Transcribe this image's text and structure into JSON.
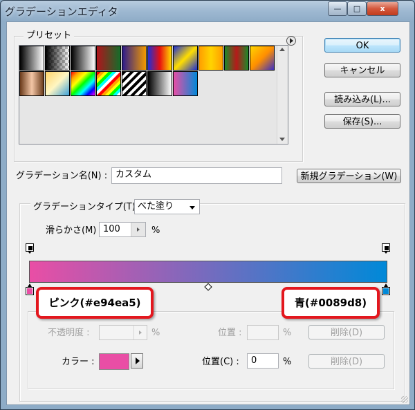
{
  "window": {
    "title": "グラデーションエディタ",
    "minimize_glyph": "—",
    "maximize_glyph": "□",
    "close_glyph": "x"
  },
  "presets": {
    "label": "プリセット",
    "menu_icon": "circle-arrow-right-icon",
    "swatches": [
      "linear-gradient(90deg,#000,#fff)",
      "linear-gradient(90deg,#000,#fff) , repeating-conic-gradient(#ccc 0 25%,#fff 0 50%)",
      "linear-gradient(90deg,#000,#fff)",
      "linear-gradient(90deg,#b0141c,#146d2a)",
      "linear-gradient(90deg,#2c1b8c,#f29a00)",
      "linear-gradient(90deg,#1f2fd6,#e80f0f,#ffde00)",
      "linear-gradient(135deg,#1d2fd4,#ffde00,#1d2fd4)",
      "linear-gradient(90deg,#ff9e00,#ffd400,#ff9e00)",
      "linear-gradient(90deg,#1b8a2a,#b61a1a,#1b8a2a)",
      "linear-gradient(135deg,#ffd400,#ff8f00,#3a2fc4)",
      "linear-gradient(90deg,#6a3a1a,#f3c6a6,#6a3a1a)",
      "linear-gradient(135deg,#ffd46a,#fff6c2,#3aa0d8)",
      "linear-gradient(135deg,red,orange,yellow,lime,cyan,blue,magenta)",
      "repeating-linear-gradient(135deg,red 0 4px,orange 4px 8px,yellow 8px 12px,lime 12px 16px,cyan 16px 20px,#fff 20px 24px)",
      "repeating-linear-gradient(135deg,#000 0 4px,#fff 4px 8px)",
      "linear-gradient(90deg,#000,#fff)",
      "linear-gradient(90deg,#e94ea5,#0089d8)"
    ]
  },
  "buttons": {
    "ok": "OK",
    "cancel": "キャンセル",
    "load": "読み込み(L)...",
    "save": "保存(S)...",
    "new_gradient": "新規グラデーション(W)",
    "delete_opacity": "削除(D)",
    "delete_color": "削除(D)"
  },
  "name_field": {
    "label": "グラデーション名(N) :",
    "value": "カスタム"
  },
  "gradient_type": {
    "label": "グラデーションタイプ(T) :",
    "value": "べた塗り",
    "smoothness_label": "滑らかさ(M) :",
    "smoothness_value": "100",
    "percent": "%"
  },
  "gradient": {
    "start_color": "#e94ea5",
    "end_color": "#0089d8",
    "midpoint": 50
  },
  "callouts": {
    "left": "ピンク(#e94ea5)",
    "right": "青(#0089d8)"
  },
  "stops_panel": {
    "opacity_label": "不透明度 :",
    "opacity_percent": "%",
    "opacity_position_label": "位置 :",
    "opacity_position_percent": "%",
    "color_label": "カラー :",
    "color_value": "#e94ea5",
    "color_position_label": "位置(C) :",
    "color_position_value": "0",
    "color_position_percent": "%"
  }
}
